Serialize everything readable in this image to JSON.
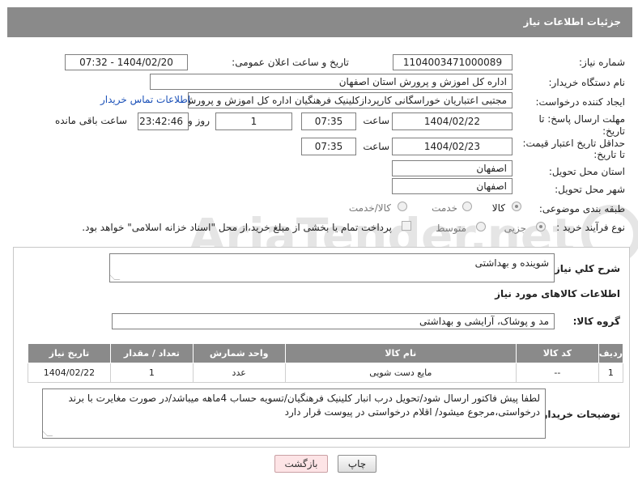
{
  "header": {
    "title": "جزئیات اطلاعات نیاز"
  },
  "form": {
    "need_number": {
      "label": "شماره نیاز:",
      "value": "1104003471000089"
    },
    "announce_datetime": {
      "label": "تاریخ و ساعت اعلان عمومی:",
      "value": "1404/02/20 - 07:32"
    },
    "buyer_org": {
      "label": "نام دستگاه خریدار:",
      "value": "اداره کل اموزش و پرورش استان اصفهان"
    },
    "requester": {
      "label": "ایجاد کننده درخواست:",
      "value": "مجتبی اعتباریان خوراسگانی کارپردازکلینیک فرهنگیان اداره کل اموزش و پرورش ا"
    },
    "contact_link": "اطلاعات تماس خریدار",
    "reply_deadline": {
      "label_line1": "مهلت ارسال پاسخ: تا",
      "label_line2": "تاریخ:",
      "date": "1404/02/22",
      "time_label": "ساعت",
      "time": "07:35",
      "days": "1",
      "days_label": "روز و",
      "remaining": "23:42:46",
      "remaining_label": "ساعت باقی مانده"
    },
    "price_validity": {
      "label_line1": "حداقل تاریخ اعتبار قیمت:",
      "label_line2": "تا تاریخ:",
      "date": "1404/02/23",
      "time_label": "ساعت",
      "time": "07:35"
    },
    "delivery_province": {
      "label": "استان محل تحویل:",
      "value": "اصفهان"
    },
    "delivery_city": {
      "label": "شهر محل تحویل:",
      "value": "اصفهان"
    },
    "category": {
      "label": "طبقه بندی موضوعی:",
      "options": [
        "کالا",
        "خدمت",
        "کالا/خدمت"
      ],
      "selected": "کالا"
    },
    "purchase_process": {
      "label": "نوع فرآیند خرید :",
      "options": [
        "جزیی",
        "متوسط"
      ],
      "selected": "جزیی",
      "payment_note": "پرداخت تمام یا بخشی از مبلغ خرید،از محل \"اسناد خزانه اسلامی\" خواهد بود."
    }
  },
  "details": {
    "summary_label": "شرح کلي نياز:",
    "summary_value": "شوینده و بهداشتی",
    "goods_section_title": "اطلاعات کالاهای مورد نیاز",
    "goods_group_label": "گروه کالا:",
    "goods_group_value": "مد و پوشاک، آرایشی و بهداشتی",
    "table": {
      "headers": [
        "ردیف",
        "کد کالا",
        "نام کالا",
        "واحد شمارش",
        "تعداد / مقدار",
        "تاریخ نیاز"
      ],
      "rows": [
        [
          "1",
          "--",
          "مایع دست شویی",
          "عدد",
          "1",
          "1404/02/22"
        ]
      ]
    },
    "buyer_notes_label": "توضیحات خریدار:",
    "buyer_notes_value": "لطفا پیش فاکتور ارسال شود/تحویل درب انبار کلینیک فرهنگیان/تسویه حساب 4ماهه میباشد/در صورت مغایرت با برند درخواستی،مرجوع میشود/ اقلام درخواستی در پیوست قرار دارد"
  },
  "buttons": {
    "print": "چاپ",
    "back": "بازگشت"
  },
  "watermark": "AriaTender.net"
}
